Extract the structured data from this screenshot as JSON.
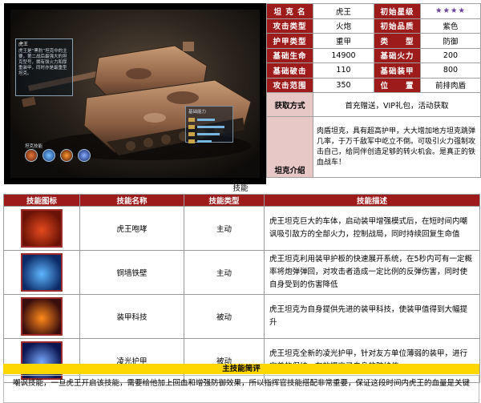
{
  "hero": {
    "tank_name_small": "虎王",
    "tank_desc_small": "虎王是“黑豹”坦克中的主要，第二战后最强大的坦克型号，拥有强火力和厚重装甲，同时亦是最重型坦克。",
    "stat_panel_title": "基础能力",
    "skills_strip_label": "坦克技能"
  },
  "info": {
    "rows": [
      {
        "k1": "坦 克 名",
        "v1": "虎王",
        "k2": "初始星级",
        "v2": "★★★★"
      },
      {
        "k1": "攻击类型",
        "v1": "火炮",
        "k2": "初始品质",
        "v2": "紫色"
      },
      {
        "k1": "护甲类型",
        "v1": "重甲",
        "k2": "类　　型",
        "v2": "防御"
      },
      {
        "k1": "基础生命",
        "v1": "14900",
        "k2": "基础火力",
        "v2": "200"
      },
      {
        "k1": "基础破击",
        "v1": "110",
        "k2": "基础装甲",
        "v2": "800"
      },
      {
        "k1": "攻击范围",
        "v1": "350",
        "k2": "位　　置",
        "v2": "前排肉盾"
      }
    ],
    "obtain_label": "获取方式",
    "obtain_value": "首充赠送，VIP礼包，活动获取",
    "intro_label": "坦克介绍",
    "intro_value": "肉盾坦克，具有超高护甲，大大增加地方坦克跳弹几率，于万千敌军中屹立不倒。可吸引火力强制攻击自己，给同伴创造足够的转火机会。是真正的铁血战车！"
  },
  "skills_caption": "技能",
  "skills": {
    "headers": [
      "技能图标",
      "技能名称",
      "技能类型",
      "技能描述"
    ],
    "rows": [
      {
        "name": "虎王咆哮",
        "type": "主动",
        "desc": "虎王坦克巨大的车体，启动装甲增强模式后，在短时间内嘲讽吸引敌方的全部火力，控制战局，同时持续回复生命值",
        "icon": "tank-roar-icon",
        "c1": "#e44b1e",
        "c2": "#6a1206"
      },
      {
        "name": "铜墙铁壁",
        "type": "主动",
        "desc": "虎王坦克利用装甲护板的快速展开系统，在5秒内可有一定概率将炮弹弹回，对攻击者造成一定比例的反弹伤害，同时使自身受到的伤害降低",
        "icon": "iron-wall-icon",
        "c1": "#5fb7ff",
        "c2": "#0b2a66"
      },
      {
        "name": "装甲科技",
        "type": "被动",
        "desc": "虎王坦克为自身提供先进的装甲科技，使装甲值得到大幅提升",
        "icon": "armor-tech-icon",
        "c1": "#ff8a1a",
        "c2": "#3a0d0d"
      },
      {
        "name": "凌光护甲",
        "type": "被动",
        "desc": "虎王坦克全新的凌光护甲，针对友方单位薄弱的装甲，进行完美的保护，有效提高了自身的防护值",
        "icon": "light-armor-icon",
        "c1": "#79a8ff",
        "c2": "#0a1550"
      }
    ]
  },
  "summary": {
    "title": "主技能简评",
    "body": "嘲讽技能，一旦虎王开启该技能，需要给他加上回血和增强防御效果，所以指挥官技能搭配非常重要，保证这段时间内虎王的血量是关键"
  }
}
